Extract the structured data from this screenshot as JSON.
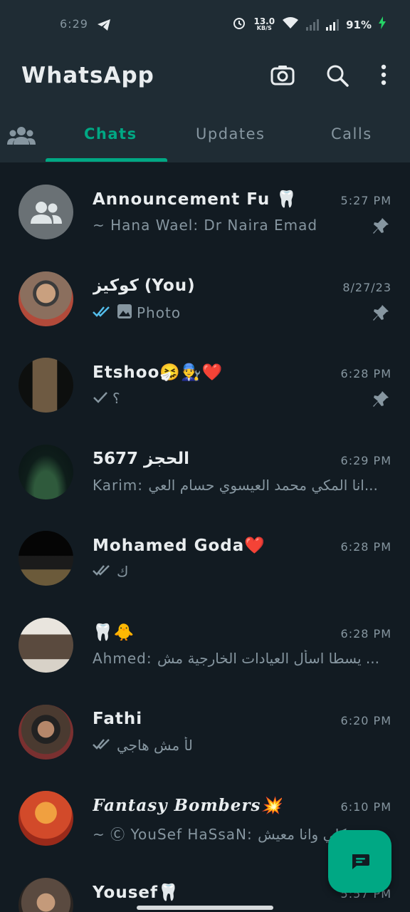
{
  "status": {
    "time": "6:29",
    "speed_value": "13.0",
    "speed_unit": "KB/S",
    "battery": "91%"
  },
  "app": {
    "title": "WhatsApp"
  },
  "tabs": [
    {
      "label": "Chats",
      "active": true
    },
    {
      "label": "Updates",
      "active": false
    },
    {
      "label": "Calls",
      "active": false
    }
  ],
  "chats": [
    {
      "name": "Announcement Fu 🦷",
      "preview": "~ Hana Wael: Dr Naira Emad",
      "time": "5:27 PM",
      "pinned": true
    },
    {
      "name": "كوكيز (You)",
      "preview": "Photo",
      "time": "8/27/23",
      "pinned": true
    },
    {
      "name": "Etshoo🤧👨‍🔧❤️",
      "preview": "؟",
      "time": "6:28 PM",
      "pinned": true
    },
    {
      "name": "5677 الحجز",
      "preview": "Karim: انا المكي محمد العيسوي حسام العي...",
      "time": "6:29 PM",
      "pinned": false
    },
    {
      "name": "Mohamed Goda❤️",
      "preview": "ك",
      "time": "6:28 PM",
      "pinned": false
    },
    {
      "name": "🦷🐥",
      "preview": "Ahmed: يسطا اسأل العيادات الخارجية مش ...",
      "time": "6:28 PM",
      "pinned": false
    },
    {
      "name": "Fathi",
      "preview": "لأ مش هاجي",
      "time": "6:20 PM",
      "pinned": false
    },
    {
      "name": "Fantasy Bombers💥",
      "preview": "~ Ⓒ YouSef HaSsaN: شكلي وانا معيش...",
      "time": "6:10 PM",
      "pinned": false
    },
    {
      "name": "Yousef🦷",
      "preview": "",
      "time": "5:57 PM",
      "pinned": false
    }
  ],
  "colors": {
    "accent": "#00a884",
    "header": "#1f2c34",
    "background": "#121b22",
    "read_tick": "#53bdeb"
  }
}
